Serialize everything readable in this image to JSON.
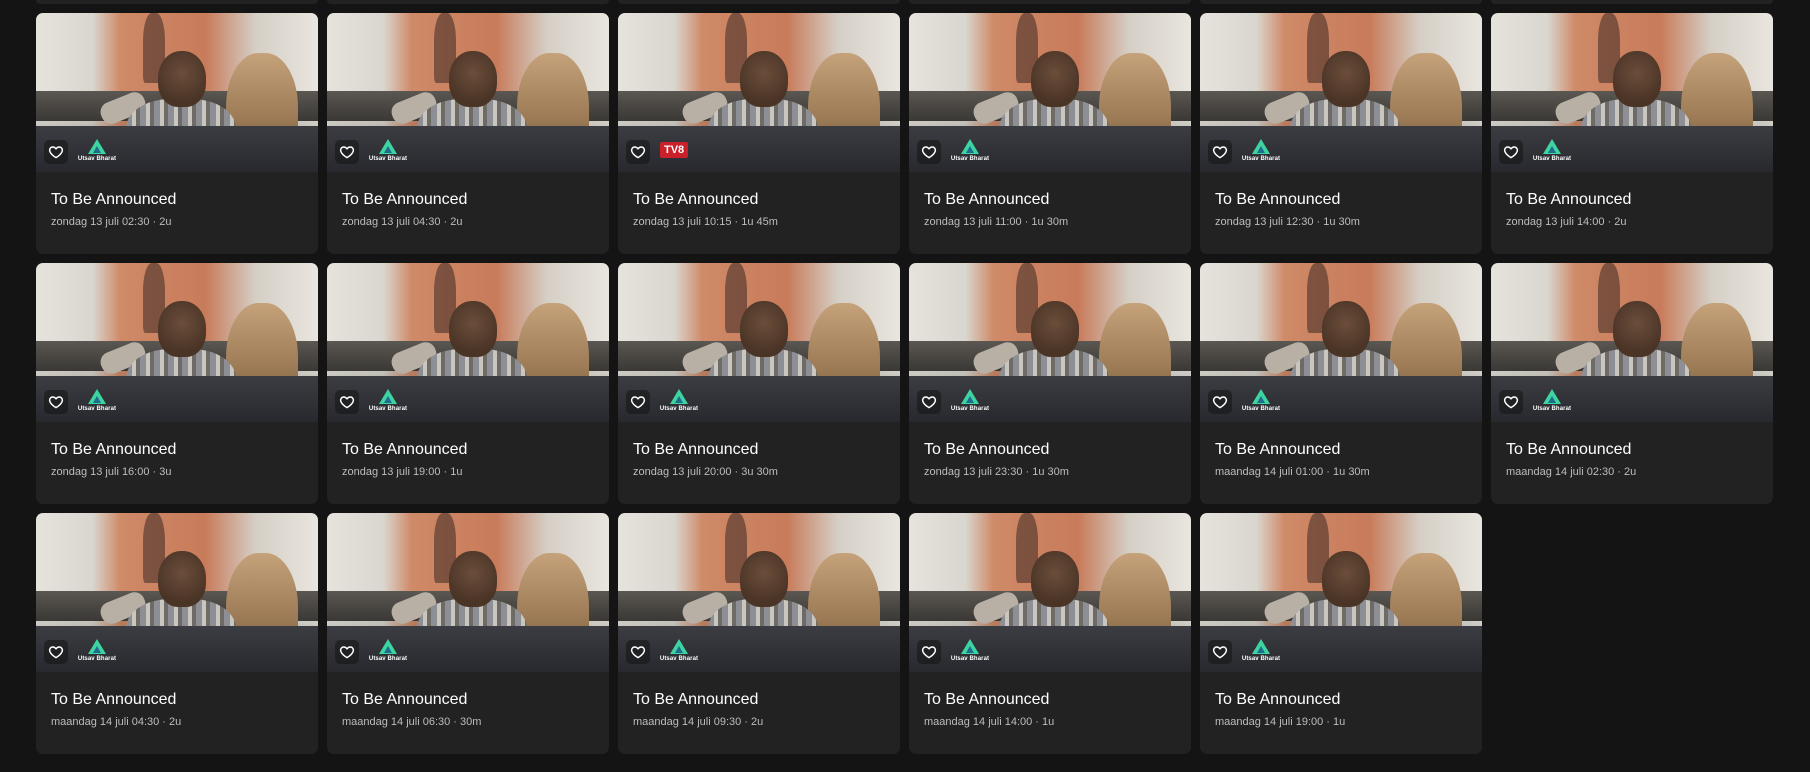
{
  "colors": {
    "background": "#141414",
    "card": "#222222",
    "title": "#ffffff",
    "meta": "#bdbdbd",
    "utsav_accent": "#3ed4a0",
    "tv8_red": "#c9202a"
  },
  "icons": {
    "favorite": "heart-outline-icon"
  },
  "programs": [
    {
      "title": "To Be Announced",
      "meta": "zondag 13 juli 02:30 · 2u",
      "channel": "Utsav Bharat",
      "logo": "utsav"
    },
    {
      "title": "To Be Announced",
      "meta": "zondag 13 juli 04:30 · 2u",
      "channel": "Utsav Bharat",
      "logo": "utsav"
    },
    {
      "title": "To Be Announced",
      "meta": "zondag 13 juli 10:15 · 1u 45m",
      "channel": "TV8",
      "logo": "tv8"
    },
    {
      "title": "To Be Announced",
      "meta": "zondag 13 juli 11:00 · 1u 30m",
      "channel": "Utsav Bharat",
      "logo": "utsav"
    },
    {
      "title": "To Be Announced",
      "meta": "zondag 13 juli 12:30 · 1u 30m",
      "channel": "Utsav Bharat",
      "logo": "utsav"
    },
    {
      "title": "To Be Announced",
      "meta": "zondag 13 juli 14:00 · 2u",
      "channel": "Utsav Bharat",
      "logo": "utsav"
    },
    {
      "title": "To Be Announced",
      "meta": "zondag 13 juli 16:00 · 3u",
      "channel": "Utsav Bharat",
      "logo": "utsav"
    },
    {
      "title": "To Be Announced",
      "meta": "zondag 13 juli 19:00 · 1u",
      "channel": "Utsav Bharat",
      "logo": "utsav"
    },
    {
      "title": "To Be Announced",
      "meta": "zondag 13 juli 20:00 · 3u 30m",
      "channel": "Utsav Bharat",
      "logo": "utsav"
    },
    {
      "title": "To Be Announced",
      "meta": "zondag 13 juli 23:30 · 1u 30m",
      "channel": "Utsav Bharat",
      "logo": "utsav"
    },
    {
      "title": "To Be Announced",
      "meta": "maandag 14 juli 01:00 · 1u 30m",
      "channel": "Utsav Bharat",
      "logo": "utsav"
    },
    {
      "title": "To Be Announced",
      "meta": "maandag 14 juli 02:30 · 2u",
      "channel": "Utsav Bharat",
      "logo": "utsav"
    },
    {
      "title": "To Be Announced",
      "meta": "maandag 14 juli 04:30 · 2u",
      "channel": "Utsav Bharat",
      "logo": "utsav"
    },
    {
      "title": "To Be Announced",
      "meta": "maandag 14 juli 06:30 · 30m",
      "channel": "Utsav Bharat",
      "logo": "utsav"
    },
    {
      "title": "To Be Announced",
      "meta": "maandag 14 juli 09:30 · 2u",
      "channel": "Utsav Bharat",
      "logo": "utsav"
    },
    {
      "title": "To Be Announced",
      "meta": "maandag 14 juli 14:00 · 1u",
      "channel": "Utsav Bharat",
      "logo": "utsav"
    },
    {
      "title": "To Be Announced",
      "meta": "maandag 14 juli 19:00 · 1u",
      "channel": "Utsav Bharat",
      "logo": "utsav"
    }
  ]
}
